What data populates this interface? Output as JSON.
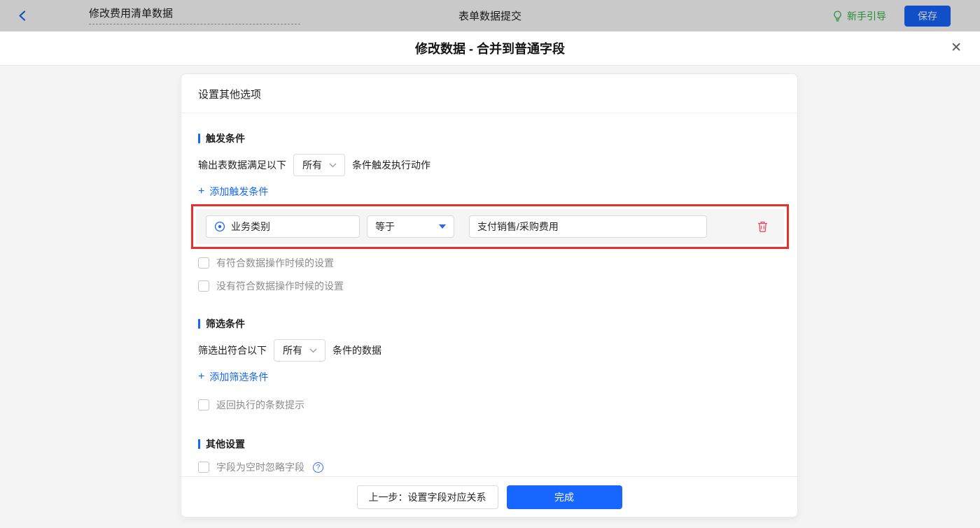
{
  "topbar": {
    "flow_title": "修改费用清单数据",
    "page_title": "表单数据提交",
    "guide_label": "新手引导",
    "save_label": "保存"
  },
  "modal": {
    "title": "修改数据 - 合并到普通字段"
  },
  "icons": {
    "plus": "+",
    "close": "✕",
    "question": "?",
    "back": "back-chevron",
    "lightbulb": "lightbulb",
    "target": "target-radio",
    "trash": "trash-can",
    "caret": "caret-down",
    "chevron": "chevron-down"
  },
  "panel": {
    "header": "设置其他选项",
    "trigger": {
      "section_title": "触发条件",
      "sentence_prefix": "输出表数据满足以下",
      "match_value": "所有",
      "sentence_suffix": "条件触发执行动作",
      "add_label": "添加触发条件",
      "condition": {
        "field": "业务类别",
        "operator": "等于",
        "value": "支付销售/采购费用"
      },
      "checkbox_has_match": "有符合数据操作时候的设置",
      "checkbox_no_match": "没有符合数据操作时候的设置"
    },
    "filter": {
      "section_title": "筛选条件",
      "sentence_prefix": "筛选出符合以下",
      "match_value": "所有",
      "sentence_suffix": "条件的数据",
      "add_label": "添加筛选条件",
      "checkbox_count_tip": "返回执行的条数提示"
    },
    "other": {
      "section_title": "其他设置",
      "checkbox_ignore_empty": "字段为空时忽略字段"
    },
    "footer": {
      "prev_label": "上一步：设置字段对应关系",
      "done_label": "完成"
    }
  },
  "colors": {
    "primary_blue": "#1666ff",
    "annotation_red": "#ec2d30",
    "danger_red": "#f0485a",
    "guide_green": "#2fb344",
    "dim_mask": "rgba(0,0,0,0.21)"
  }
}
